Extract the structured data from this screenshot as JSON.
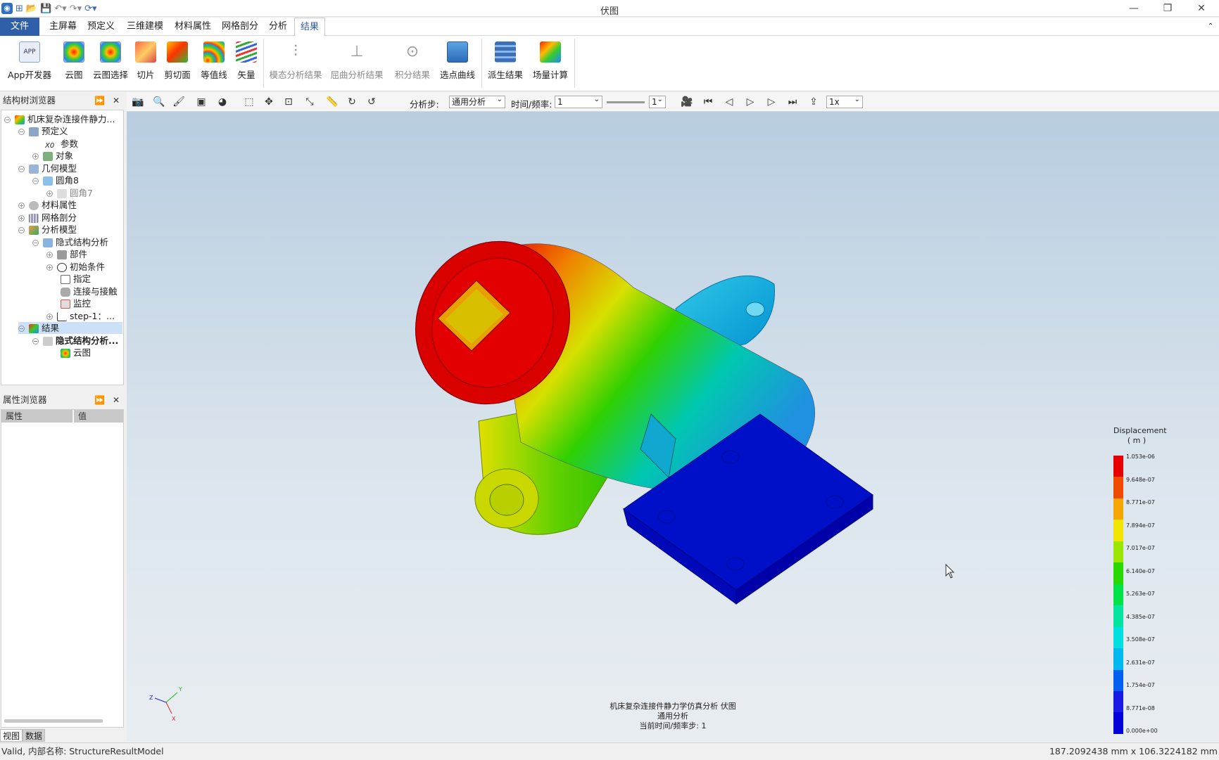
{
  "window": {
    "title": "伏图"
  },
  "menu": {
    "file": "文件",
    "tabs": [
      "主屏幕",
      "预定义",
      "三维建模",
      "材料属性",
      "网格剖分",
      "分析",
      "结果"
    ],
    "active": "结果"
  },
  "ribbon": {
    "items": [
      "App开发器",
      "云图",
      "云图选择",
      "切片",
      "剪切面",
      "等值线",
      "矢量",
      "模态分析结果",
      "屈曲分析结果",
      "积分结果",
      "选点曲线",
      "派生结果",
      "场量计算"
    ],
    "app_icon_text": "APP"
  },
  "tree_panel": {
    "title": "结构树浏览器",
    "nodes": [
      "机床复杂连接件静力...",
      "预定义",
      "参数",
      "对象",
      "几何模型",
      "圆角8",
      "圆角7",
      "材料属性",
      "网格剖分",
      "分析模型",
      "隐式结构分析",
      "部件",
      "初始条件",
      "指定",
      "连接与接触",
      "监控",
      "step-1：...",
      "结果",
      "隐式结构分析...",
      "云图"
    ],
    "param_prefix": "X0"
  },
  "props_panel": {
    "title": "属性浏览器",
    "col_property": "属性",
    "col_value": "值"
  },
  "bottom_tabs": [
    "视图",
    "数据"
  ],
  "view_toolbar": {
    "step_label": "分析步:",
    "step_value": "通用分析",
    "time_label": "时间/频率:",
    "time_value": "1",
    "frame_value": "1",
    "speed_value": "1x"
  },
  "legend": {
    "title": "Displacement",
    "unit": "( m )",
    "labels": [
      "1.053e-06",
      "9.648e-07",
      "8.771e-07",
      "7.894e-07",
      "7.017e-07",
      "6.140e-07",
      "5.263e-07",
      "4.385e-07",
      "3.508e-07",
      "2.631e-07",
      "1.754e-07",
      "8.771e-08",
      "0.000e+00"
    ],
    "colors": [
      "#e60000",
      "#f04a00",
      "#f5a600",
      "#f2e600",
      "#9be600",
      "#27d900",
      "#00e14a",
      "#00e6a0",
      "#00e0e0",
      "#00b8f0",
      "#0060f0",
      "#1a1ae6",
      "#0000d9"
    ]
  },
  "viewport_info": {
    "line1": "机床复杂连接件静力学仿真分析  伏图",
    "line2": "通用分析",
    "line3": "当前时间/频率步: 1"
  },
  "axes": {
    "x": "X",
    "y": "Y",
    "z": "Z"
  },
  "statusbar": {
    "left": "Valid, 内部名称: StructureResultModel",
    "right": "187.2092438 mm x 106.3224182 mm"
  }
}
